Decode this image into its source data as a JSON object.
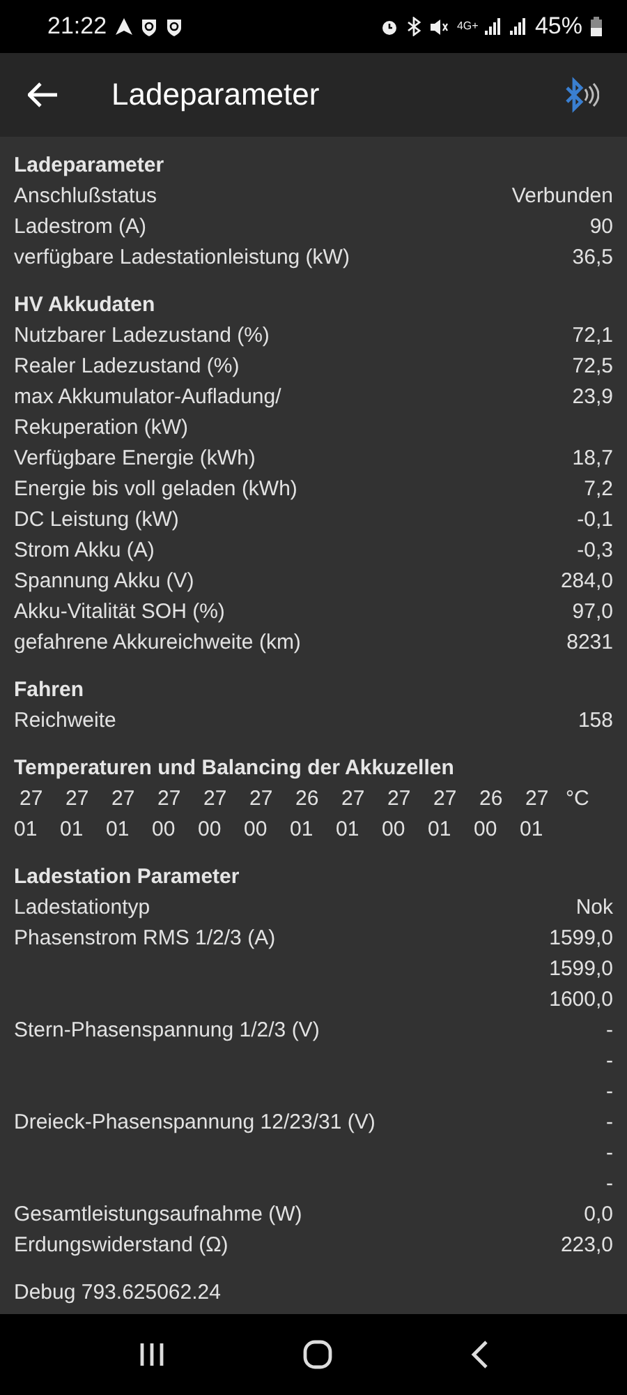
{
  "status_bar": {
    "time": "21:22",
    "network": "4G+",
    "battery": "45%"
  },
  "app_bar": {
    "title": "Ladeparameter"
  },
  "sections": [
    {
      "kind": "rows",
      "title": "Ladeparameter",
      "rows": [
        {
          "label": "Anschlußstatus",
          "values": [
            "Verbunden"
          ]
        },
        {
          "label": "Ladestrom (A)",
          "values": [
            "90"
          ]
        },
        {
          "label": "verfügbare Ladestationleistung (kW)",
          "values": [
            "36,5"
          ]
        }
      ]
    },
    {
      "kind": "rows",
      "title": "HV Akkudaten",
      "rows": [
        {
          "label": "Nutzbarer Ladezustand (%)",
          "values": [
            "72,1"
          ]
        },
        {
          "label": "Realer Ladezustand (%)",
          "values": [
            "72,5"
          ]
        },
        {
          "label": "max Akkumulator-Aufladung/ Rekuperation (kW)",
          "values": [
            "23,9"
          ]
        },
        {
          "label": "Verfügbare Energie (kWh)",
          "values": [
            "18,7"
          ]
        },
        {
          "label": "Energie bis voll geladen (kWh)",
          "values": [
            "7,2"
          ]
        },
        {
          "label": "DC Leistung (kW)",
          "values": [
            "-0,1"
          ]
        },
        {
          "label": "Strom Akku (A)",
          "values": [
            "-0,3"
          ]
        },
        {
          "label": "Spannung Akku (V)",
          "values": [
            "284,0"
          ]
        },
        {
          "label": "Akku-Vitalität SOH (%)",
          "values": [
            "97,0"
          ]
        },
        {
          "label": "gefahrene Akkureichweite (km)",
          "values": [
            "8231"
          ]
        }
      ]
    },
    {
      "kind": "rows",
      "title": "Fahren",
      "rows": [
        {
          "label": "Reichweite",
          "values": [
            "158"
          ]
        }
      ]
    },
    {
      "kind": "cells",
      "title": "Temperaturen und Balancing der Akkuzellen",
      "temperatures": [
        "27",
        "27",
        "27",
        "27",
        "27",
        "27",
        "26",
        "27",
        "27",
        "27",
        "26",
        "27"
      ],
      "unit": "°C",
      "balancing": [
        "01",
        "01",
        "01",
        "00",
        "00",
        "00",
        "01",
        "01",
        "00",
        "01",
        "00",
        "01"
      ]
    },
    {
      "kind": "rows",
      "title": "Ladestation Parameter",
      "rows": [
        {
          "label": "Ladestationtyp",
          "values": [
            "Nok"
          ]
        },
        {
          "label": "Phasenstrom RMS 1/2/3 (A)",
          "values": [
            "1599,0",
            "1599,0",
            "1600,0"
          ]
        },
        {
          "label": "Stern-Phasenspannung 1/2/3 (V)",
          "values": [
            "-",
            "-",
            "-"
          ]
        },
        {
          "label": "Dreieck-Phasenspannung 12/23/31 (V)",
          "values": [
            "-",
            "-",
            "-"
          ]
        },
        {
          "label": "Gesamtleistungsaufnahme (W)",
          "values": [
            "0,0"
          ]
        },
        {
          "label": "Erdungswiderstand (Ω)",
          "values": [
            "223,0"
          ]
        }
      ]
    }
  ],
  "debug": "Debug 793.625062.24"
}
